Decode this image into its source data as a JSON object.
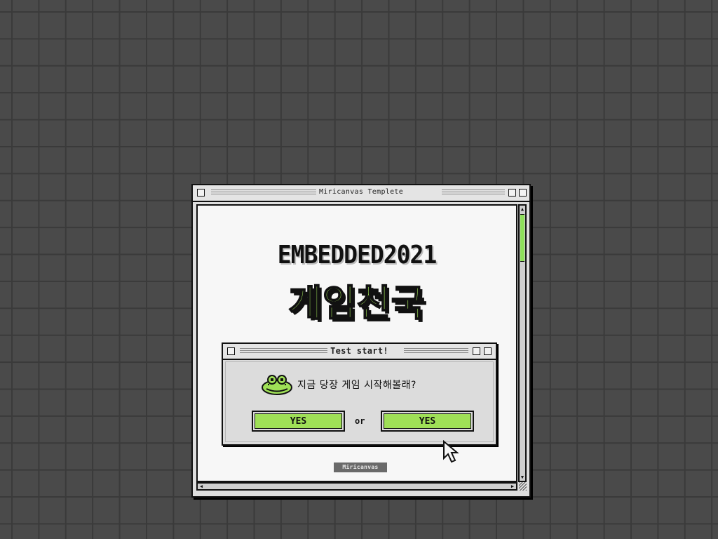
{
  "window": {
    "title": "Miricanvas Templete"
  },
  "content": {
    "heading_en": "EMBEDDED2021",
    "heading_ko": "게임천국",
    "badge": "Miricanvas"
  },
  "dialog": {
    "title": "Test start!",
    "message": "지금 당장 게임 시작해볼래?",
    "icon": "frog-icon",
    "yes_left_label": "YES",
    "or_label": "or",
    "yes_right_label": "YES"
  },
  "colors": {
    "accent_green": "#9fe057",
    "background": "#4a4a4a",
    "grid_line": "#3a3a3a",
    "window_gray": "#dedede",
    "content_white": "#f7f7f7"
  }
}
